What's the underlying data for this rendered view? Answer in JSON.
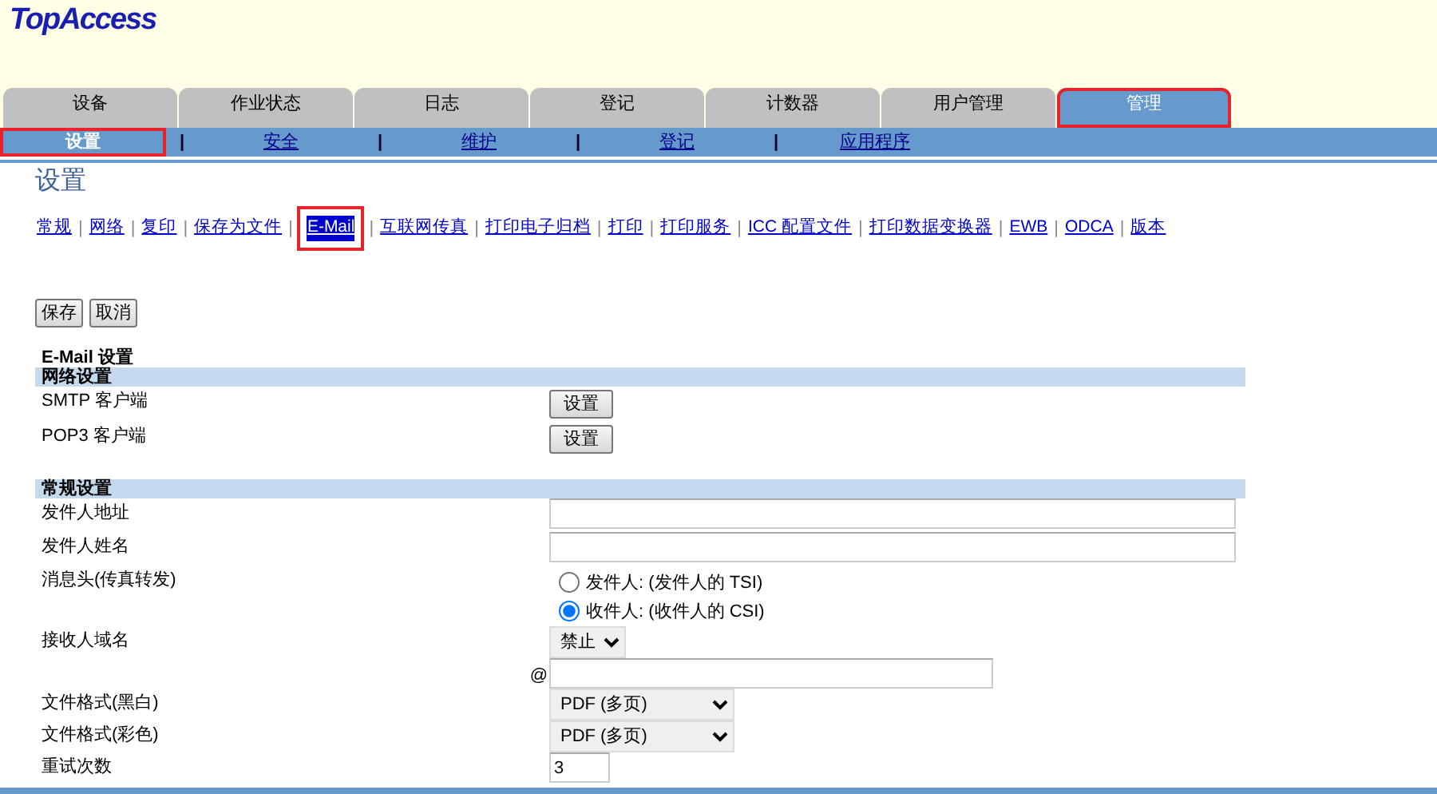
{
  "logo": "TopAccess",
  "tabs": [
    {
      "label": "设备",
      "selected": false,
      "highlighted": false
    },
    {
      "label": "作业状态",
      "selected": false,
      "highlighted": false
    },
    {
      "label": "日志",
      "selected": false,
      "highlighted": false
    },
    {
      "label": "登记",
      "selected": false,
      "highlighted": false
    },
    {
      "label": "计数器",
      "selected": false,
      "highlighted": false
    },
    {
      "label": "用户管理",
      "selected": false,
      "highlighted": false
    },
    {
      "label": "管理",
      "selected": true,
      "highlighted": true
    }
  ],
  "subnav": [
    {
      "label": "设置",
      "selected": true,
      "highlighted": true
    },
    {
      "separator_before": "|",
      "label": "安全",
      "selected": false,
      "highlighted": false
    },
    {
      "separator_before": "|",
      "label": "维护",
      "selected": false,
      "highlighted": false
    },
    {
      "separator_before": "|",
      "label": "登记",
      "selected": false,
      "highlighted": false
    },
    {
      "separator_before": "|",
      "label": "应用程序",
      "selected": false,
      "highlighted": false
    }
  ],
  "page_title": "设置",
  "links": [
    {
      "label": "常规",
      "selected": false,
      "highlighted": false
    },
    {
      "separator_before": "|",
      "label": "网络",
      "selected": false,
      "highlighted": false
    },
    {
      "separator_before": "|",
      "label": "复印",
      "selected": false,
      "highlighted": false
    },
    {
      "separator_before": "|",
      "label": "保存为文件",
      "selected": false,
      "highlighted": false
    },
    {
      "separator_before": "|",
      "label": "E-Mail",
      "selected": true,
      "highlighted": true
    },
    {
      "separator_before": "|",
      "label": "互联网传真",
      "selected": false,
      "highlighted": false
    },
    {
      "separator_before": "|",
      "label": "打印电子归档",
      "selected": false,
      "highlighted": false
    },
    {
      "separator_before": "|",
      "label": "打印",
      "selected": false,
      "highlighted": false
    },
    {
      "separator_before": "|",
      "label": "打印服务",
      "selected": false,
      "highlighted": false
    },
    {
      "separator_before": "|",
      "label": "ICC 配置文件",
      "selected": false,
      "highlighted": false
    },
    {
      "separator_before": "|",
      "label": "打印数据变换器",
      "selected": false,
      "highlighted": false
    },
    {
      "separator_before": "|",
      "label": "EWB",
      "selected": false,
      "highlighted": false
    },
    {
      "separator_before": "|",
      "label": "ODCA",
      "selected": false,
      "highlighted": false
    },
    {
      "separator_before": "|",
      "label": "版本",
      "selected": false,
      "highlighted": false
    }
  ],
  "buttons": [
    "保存",
    "取消"
  ],
  "form_title": "E-Mail 设置",
  "sections": [
    {
      "title": "网络设置",
      "rows": [
        {
          "kind": "button",
          "label": "SMTP 客户端",
          "button": "设置"
        },
        {
          "kind": "button",
          "label": "POP3 客户端",
          "button": "设置"
        }
      ]
    },
    {
      "title": "常规设置",
      "rows": [
        {
          "kind": "text",
          "label": "发件人地址"
        },
        {
          "kind": "text",
          "label": "发件人姓名"
        },
        {
          "kind": "radio",
          "label": "消息头(传真转发)",
          "options": [
            {
              "label": "发件人: (发件人的  TSI)",
              "selected": false
            },
            {
              "label": "收件人: (收件人的  CSI)",
              "selected": true
            }
          ]
        },
        {
          "kind": "select",
          "label": "接收人域名",
          "value": "禁止"
        },
        {
          "kind": "prefixed",
          "prefix": "@"
        },
        {
          "kind": "wide_select",
          "label": "文件格式(黑白)",
          "value": "PDF (多页)"
        },
        {
          "kind": "wide_select",
          "label": "文件格式(彩色)",
          "value": "PDF (多页)"
        },
        {
          "kind": "short_text",
          "label": "重试次数",
          "value": "3"
        }
      ]
    }
  ]
}
